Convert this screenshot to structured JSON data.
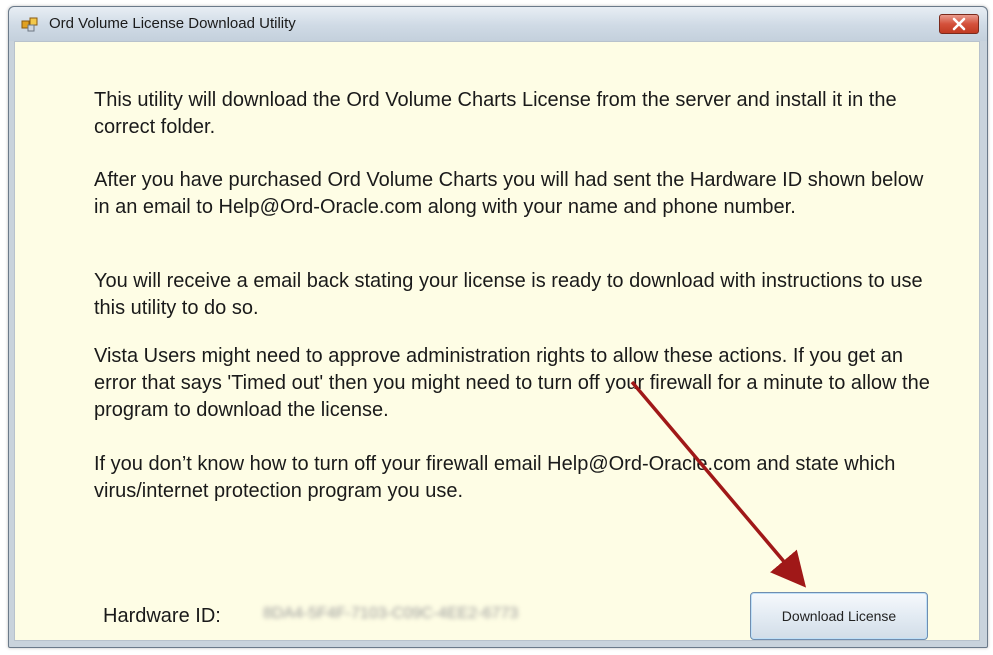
{
  "window": {
    "title": "Ord Volume License Download Utility",
    "icon": "app-icon",
    "close_icon": "close-icon"
  },
  "main": {
    "paragraphs": [
      "This utility will download the Ord Volume Charts License from the server and install it in the correct folder.",
      "After you have purchased Ord Volume Charts you will had sent the Hardware ID shown below in an email to Help@Ord-Oracle.com along with your name and phone number.",
      "You will receive a email back stating your license is ready to download with instructions to use this utility to do so.",
      "Vista Users might need to approve administration rights to allow these actions. If you get an error that says 'Timed out' then you might need to turn off your firewall for a minute to allow the program to download the license.",
      "If you don’t know how to turn off your firewall email Help@Ord-Oracle.com and state which virus/internet protection program you use."
    ],
    "hardware_id_label": "Hardware ID:",
    "hardware_id_value": "8DA4-5F4F-7103-C09C-4EE2-6773",
    "download_button_label": "Download License"
  },
  "colors": {
    "background": "#fefde5",
    "annotation_arrow": "#a01818",
    "close_button": "#c9432b"
  }
}
